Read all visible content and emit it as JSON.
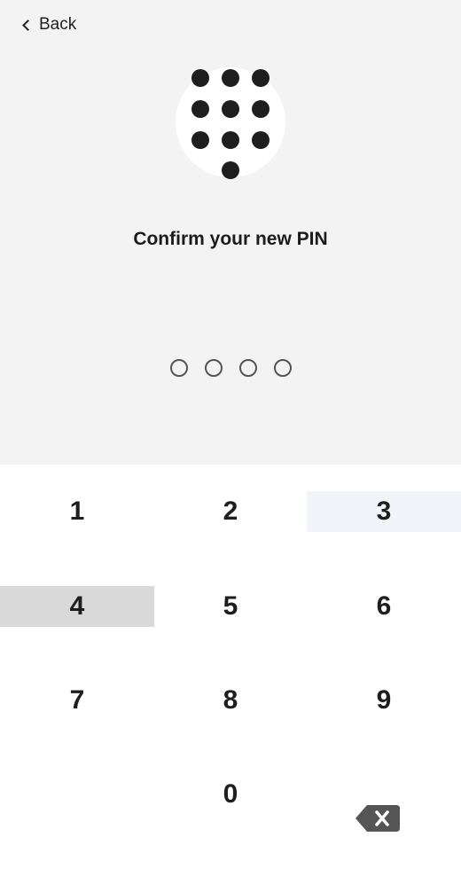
{
  "header": {
    "back_label": "Back"
  },
  "prompt": {
    "title": "Confirm your new PIN"
  },
  "pin": {
    "length": 4,
    "entered": 0
  },
  "keypad": {
    "keys": [
      "1",
      "2",
      "3",
      "4",
      "5",
      "6",
      "7",
      "8",
      "9",
      "0"
    ],
    "pressed_key": "4",
    "hovered_key": "3",
    "icons": {
      "back": "chevron-left-icon",
      "hero": "keypad-icon",
      "delete": "backspace-icon"
    }
  },
  "colors": {
    "top_background": "#f3f3f3",
    "text": "#1e1e1e",
    "pressed_key_bg": "#d9d9d9",
    "hover_key_bg": "#f1f5f9",
    "pin_dot_border": "#555555"
  }
}
